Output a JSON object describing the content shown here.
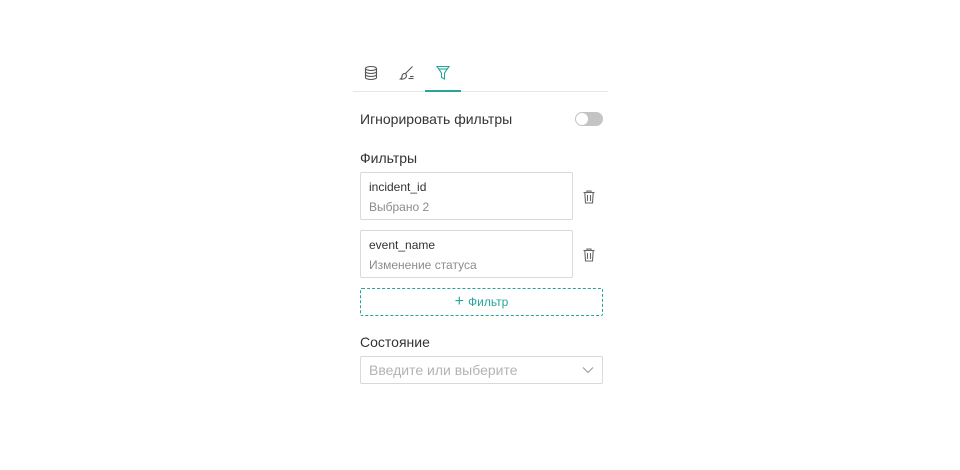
{
  "tabs": [
    {
      "icon": "database-icon",
      "active": false
    },
    {
      "icon": "brush-icon",
      "active": false
    },
    {
      "icon": "filter-icon",
      "active": true
    }
  ],
  "ignore_filters": {
    "label": "Игнорировать фильтры",
    "enabled": false
  },
  "filters": {
    "title": "Фильтры",
    "items": [
      {
        "name": "incident_id",
        "value": "Выбрано 2"
      },
      {
        "name": "event_name",
        "value": "Изменение статуса"
      }
    ],
    "add_label": "Фильтр"
  },
  "state": {
    "title": "Состояние",
    "placeholder": "Введите или выберите"
  },
  "colors": {
    "accent": "#26a69a",
    "toggle_off": "#c4c4c4",
    "border": "#d9d9d9",
    "muted_text": "#8c8c8c"
  }
}
